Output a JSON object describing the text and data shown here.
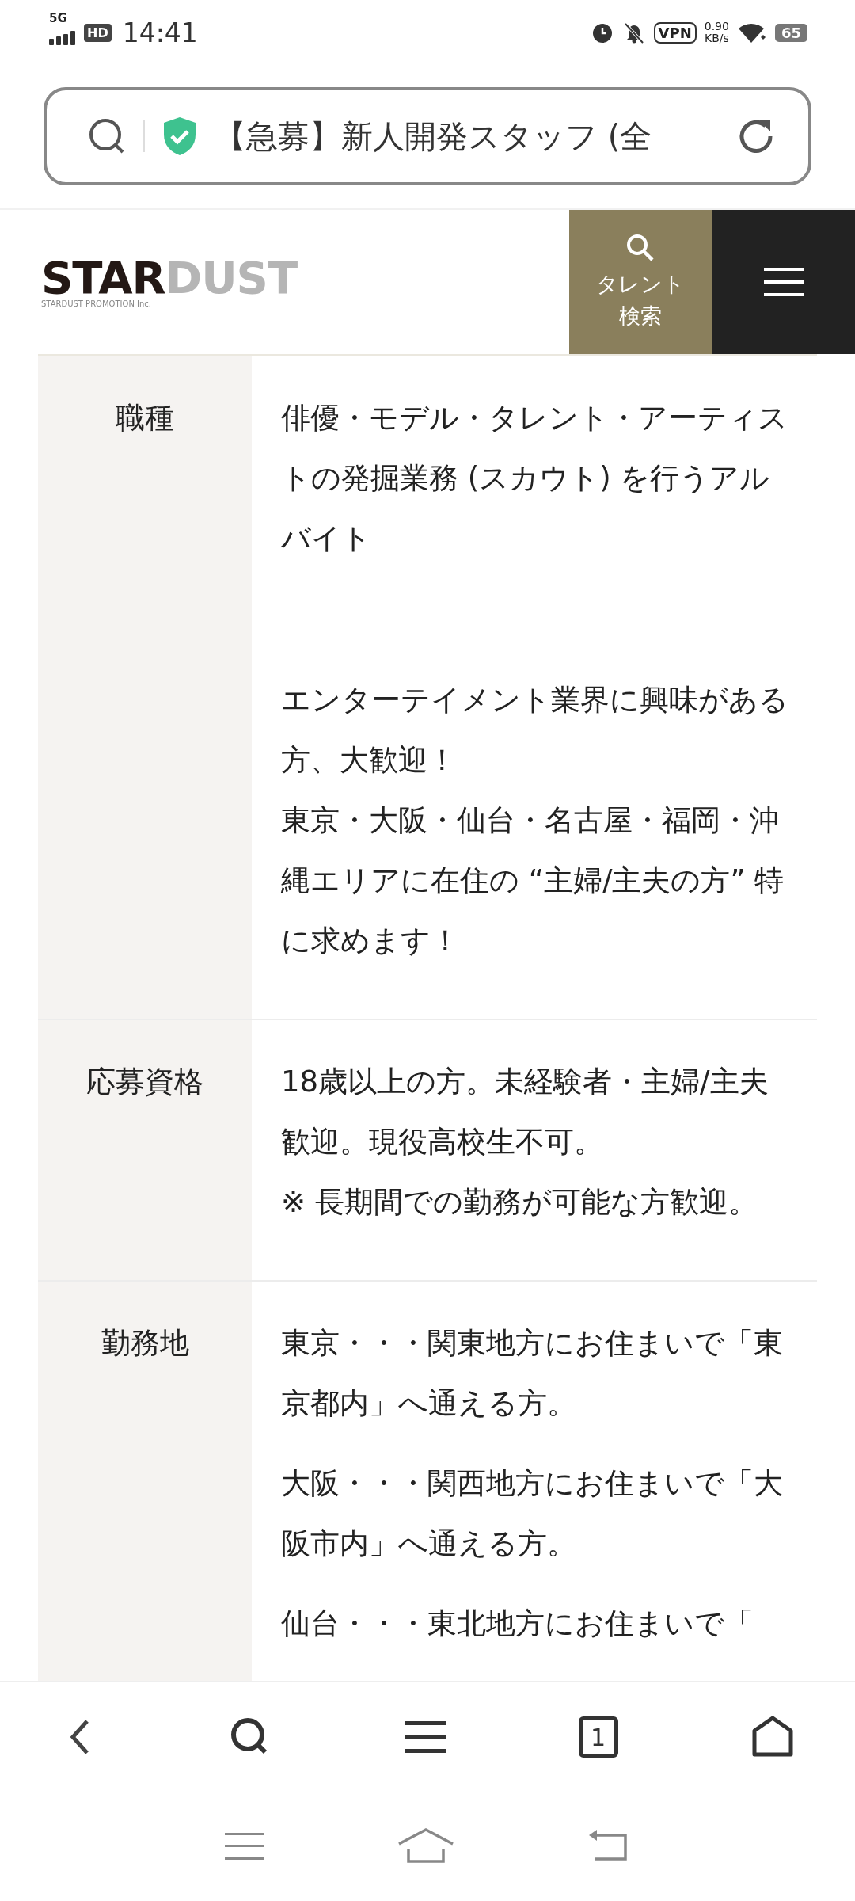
{
  "status_bar": {
    "network": "5G",
    "hd": "HD",
    "time": "14:41",
    "vpn": "VPN",
    "speed": "0.90",
    "speed_unit": "KB/s",
    "battery": "65"
  },
  "address_bar": {
    "title": "【急募】新人開発スタッフ (全"
  },
  "site_header": {
    "logo_dark": "STAR",
    "logo_light": "DUST",
    "logo_sub": "STARDUST PROMOTION Inc.",
    "search_label": "タレント検索"
  },
  "table": {
    "rows": [
      {
        "label": "職種",
        "blocks": [
          [
            "俳優・モデル・タレント・アーティストの発掘業務 (スカウト) を行うアルバイト"
          ],
          [
            "エンターテイメント業界に興味がある方、大歓迎！",
            "東京・大阪・仙台・名古屋・福岡・沖縄エリアに在住の “主婦/主夫の方” 特に求めます！"
          ]
        ]
      },
      {
        "label": "応募資格",
        "blocks": [
          [
            "18歳以上の方。未経験者・主婦/主夫歓迎。現役高校生不可。",
            "※ 長期間での勤務が可能な方歓迎。"
          ]
        ]
      },
      {
        "label": "勤務地",
        "blocks": [
          [
            "東京・・・関東地方にお住まいで「東京都内」へ通える方。"
          ],
          [
            "大阪・・・関西地方にお住まいで「大阪市内」へ通える方。"
          ],
          [
            "仙台・・・東北地方にお住まいで「"
          ]
        ]
      }
    ]
  },
  "toolbar": {
    "tab_count": "1"
  }
}
